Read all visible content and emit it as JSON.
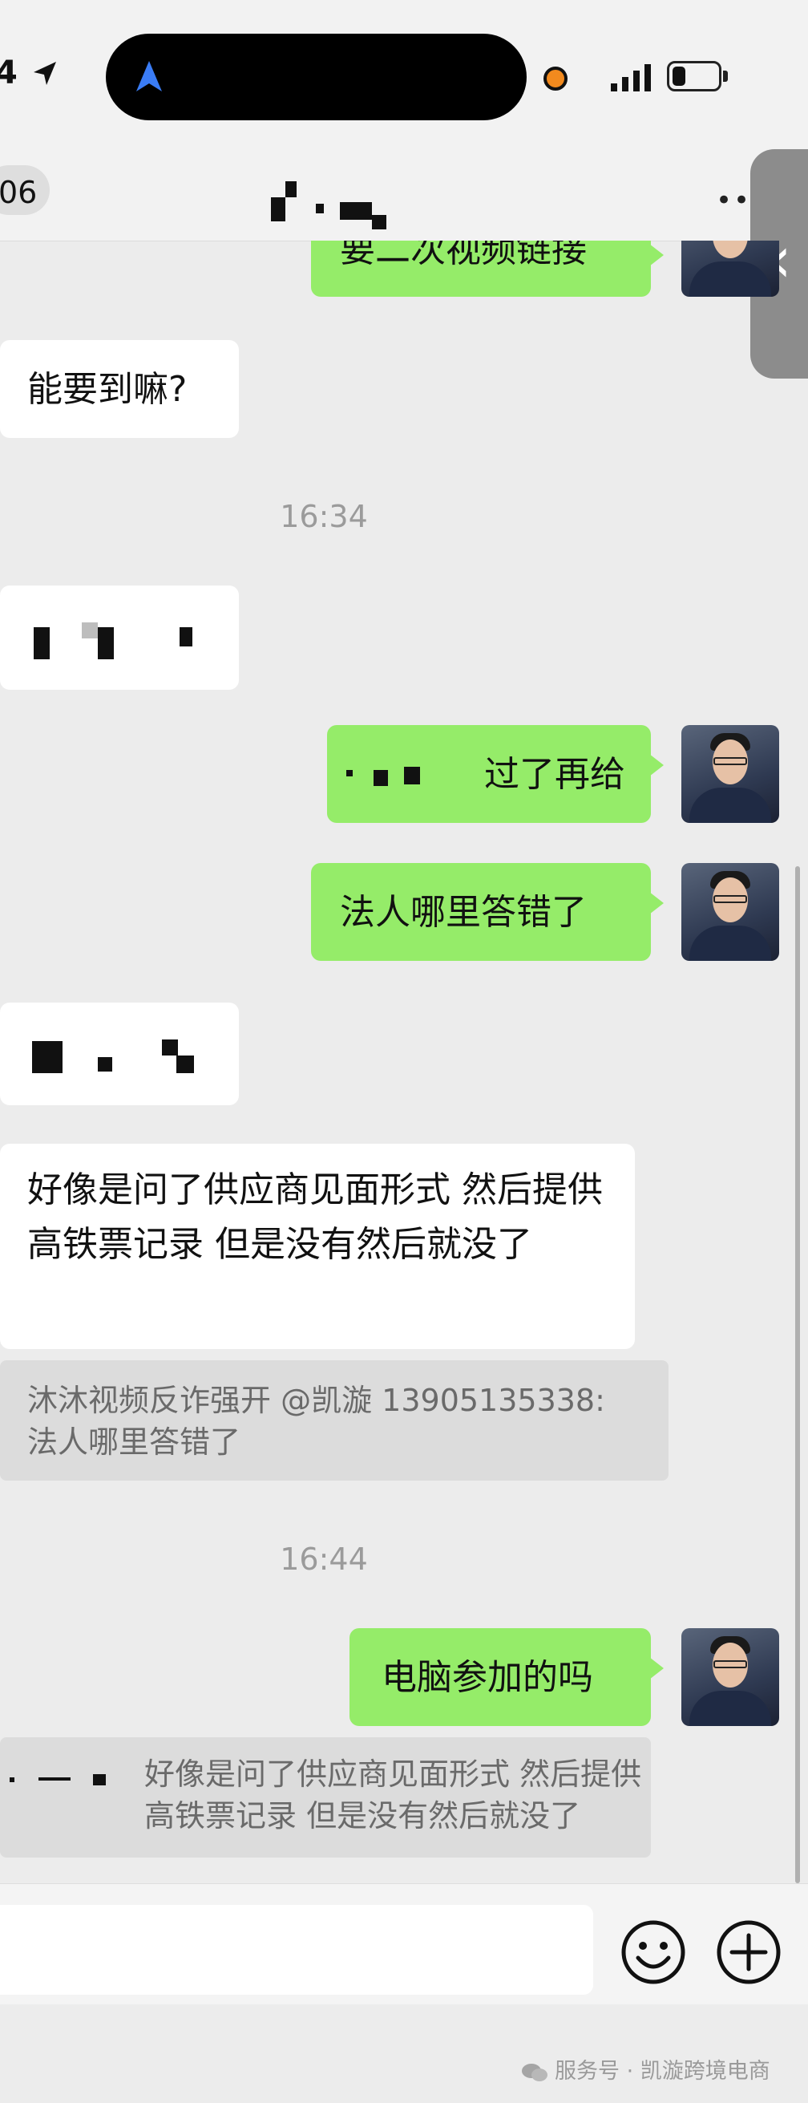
{
  "status_bar": {
    "time": "4",
    "colors": {
      "recording_dot": "#f28a1e",
      "nav_arrow": "#3a7cf5"
    }
  },
  "nav": {
    "back_count": "06",
    "more_icon": "more-icon"
  },
  "messages": {
    "top_partial": "要二次视频链接",
    "m1": "能要到嘛?",
    "ts1": "16:34",
    "m3": "过了再给",
    "m4": "法人哪里答错了",
    "m6": "好像是问了供应商见面形式 然后提供高铁票记录 但是没有然后就没了",
    "quote1": "沐沐视频反诈强开 @凯漩 13905135338: 法人哪里答错了",
    "ts2": "16:44",
    "m7": "电脑参加的吗",
    "quote2": "好像是问了供应商见面形式 然后提供高铁票记录 但是没有然后就没了"
  },
  "colors": {
    "outgoing_bubble": "#95ec69",
    "incoming_bubble": "#ffffff",
    "chat_background": "#ececec"
  },
  "input_bar": {
    "emoji_icon": "emoji-icon",
    "plus_icon": "plus-icon"
  },
  "watermark": "服务号 · 凯漩跨境电商"
}
